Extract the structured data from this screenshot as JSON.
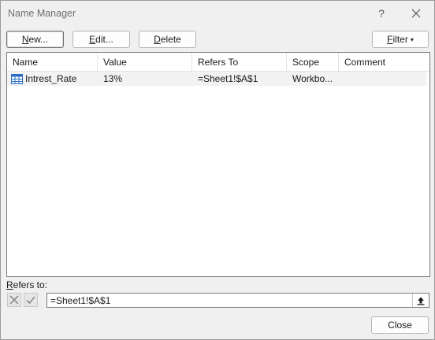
{
  "window": {
    "title": "Name Manager",
    "help_glyph": "?"
  },
  "toolbar": {
    "new_label_u": "N",
    "new_label_rest": "ew...",
    "edit_label_u": "E",
    "edit_label_rest": "dit...",
    "delete_label_u": "D",
    "delete_label_rest": "elete",
    "filter_label_u": "F",
    "filter_label_rest": "ilter",
    "filter_caret": "▾"
  },
  "list": {
    "columns": [
      "Name",
      "Value",
      "Refers To",
      "Scope",
      "Comment"
    ],
    "rows": [
      {
        "icon": "named-range-icon",
        "name": "Intrest_Rate",
        "value": "13%",
        "refers_to": "=Sheet1!$A$1",
        "scope": "Workbo...",
        "comment": ""
      }
    ]
  },
  "refers": {
    "label_u": "R",
    "label_rest": "efers to:",
    "value": "=Sheet1!$A$1"
  },
  "footer": {
    "close_label": "Close"
  },
  "colors": {
    "background": "#f0f0f0",
    "row_highlight": "#f2f2f2",
    "icon_blue": "#2b6cc4"
  }
}
